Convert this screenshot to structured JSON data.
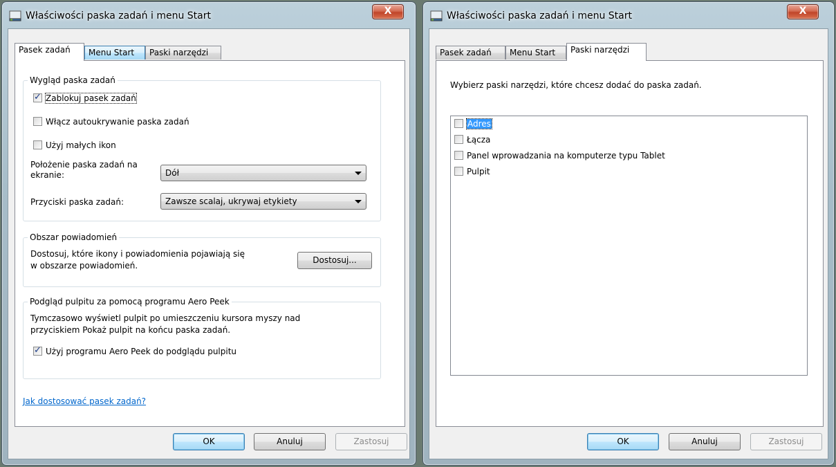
{
  "left_window": {
    "title": "Właściwości paska zadań i menu Start",
    "close_label": "X",
    "tabs": [
      "Pasek zadań",
      "Menu Start",
      "Paski narzędzi"
    ],
    "appearance_group": {
      "title": "Wygląd paska zadań",
      "lock_taskbar": "Zablokuj pasek zadań",
      "autohide": "Włącz autoukrywanie paska zadań",
      "small_icons": "Użyj małych ikon",
      "location_label": "Położenie paska zadań na ekranie:",
      "location_value": "Dół",
      "buttons_label": "Przyciski paska zadań:",
      "buttons_value": "Zawsze scalaj, ukrywaj etykiety"
    },
    "notification_group": {
      "title": "Obszar powiadomień",
      "text_line1": "Dostosuj, które ikony i powiadomienia pojawiają się",
      "text_line2": "w obszarze powiadomień.",
      "customize_button": "Dostosuj..."
    },
    "aero_group": {
      "title": "Podgląd pulpitu za pomocą programu Aero Peek",
      "text_line1": "Tymczasowo wyświetl pulpit po umieszczeniu kursora myszy nad",
      "text_line2": "przyciskiem Pokaż pulpit na końcu paska zadań.",
      "use_aero_peek": "Użyj programu Aero Peek do podglądu pulpitu"
    },
    "help_link": "Jak dostosować pasek zadań?",
    "ok_button": "OK",
    "cancel_button": "Anuluj",
    "apply_button": "Zastosuj"
  },
  "right_window": {
    "title": "Właściwości paska zadań i menu Start",
    "close_label": "X",
    "tabs": [
      "Pasek zadań",
      "Menu Start",
      "Paski narzędzi"
    ],
    "instruction": "Wybierz paski narzędzi, które chcesz dodać do paska zadań.",
    "toolbars": [
      "Adres",
      "Łącza",
      "Panel wprowadzania na komputerze typu Tablet",
      "Pulpit"
    ],
    "ok_button": "OK",
    "cancel_button": "Anuluj",
    "apply_button": "Zastosuj"
  }
}
